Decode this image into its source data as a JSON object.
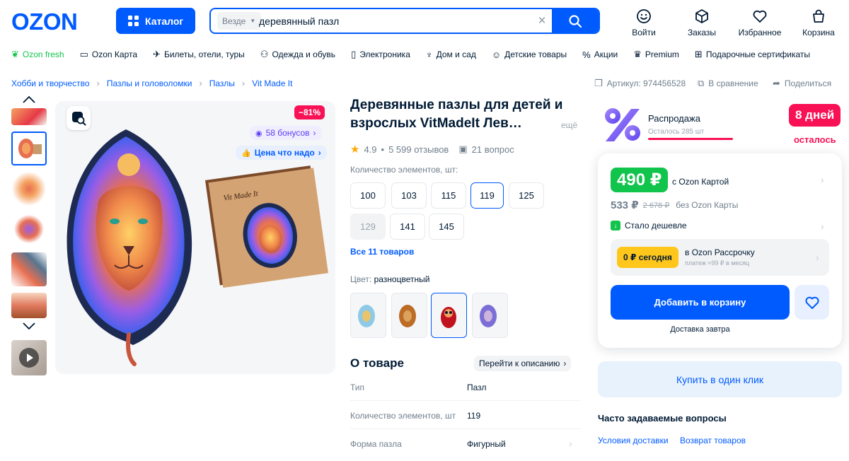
{
  "header": {
    "logo": "OZON",
    "catalog_label": "Каталог",
    "search_scope": "Везде",
    "search_value": "деревянный пазл",
    "items": [
      {
        "label": "Войти",
        "icon": "smile-icon"
      },
      {
        "label": "Заказы",
        "icon": "box-icon"
      },
      {
        "label": "Избранное",
        "icon": "heart-icon"
      },
      {
        "label": "Корзина",
        "icon": "cart-icon"
      }
    ]
  },
  "nav": [
    {
      "label": "Ozon fresh"
    },
    {
      "label": "Ozon Карта"
    },
    {
      "label": "Билеты, отели, туры"
    },
    {
      "label": "Одежда и обувь"
    },
    {
      "label": "Электроника"
    },
    {
      "label": "Дом и сад"
    },
    {
      "label": "Детские товары"
    },
    {
      "label": "Акции"
    },
    {
      "label": "Premium"
    },
    {
      "label": "Подарочные сертификаты"
    }
  ],
  "breadcrumb": [
    "Хобби и творчество",
    "Пазлы и головоломки",
    "Пазлы",
    "Vit Made It"
  ],
  "meta": {
    "article": "Артикул: 974456528",
    "compare": "В сравнение",
    "share": "Поделиться"
  },
  "gallery": {
    "discount": "−81%",
    "bonus": "58 бонусов",
    "price_tag": "Цена что надо",
    "box_text": "Vit Made It"
  },
  "product": {
    "title_line1": "Деревянные пазлы для детей и",
    "title_line2": "взрослых VitMadeIt Лев…",
    "more": "ещё",
    "rating": "4.9",
    "reviews": "5 599 отзывов",
    "questions": "21 вопрос",
    "count_label": "Количество элементов, шт:",
    "options": [
      "100",
      "103",
      "115",
      "119",
      "125",
      "129",
      "141",
      "145"
    ],
    "selected_option": "119",
    "all_products": "Все 11 товаров",
    "color_label": "Цвет:",
    "color_value": "разноцветный"
  },
  "about": {
    "title": "О товаре",
    "goto": "Перейти к описанию",
    "specs": [
      {
        "k": "Тип",
        "v": "Пазл"
      },
      {
        "k": "Количество элементов, шт",
        "v": "119"
      },
      {
        "k": "Форма пазла",
        "v": "Фигурный"
      }
    ]
  },
  "sale": {
    "title": "Распродажа",
    "left": "Осталось 285 шт",
    "days": "8 дней",
    "days_sub": "осталось"
  },
  "price": {
    "card_price": "490 ₽",
    "card_note": "с Ozon Картой",
    "regular": "533 ₽",
    "old": "2 678 ₽",
    "regular_note": "без Ozon Карты",
    "cheaper": "Стало дешевле",
    "installment_pill": "0 ₽ сегодня",
    "installment_title": "в Ozon Рассрочку",
    "installment_sub": "платеж ≈99 ₽ в месяц",
    "add_to_cart": "Добавить в корзину",
    "delivery": "Доставка завтра",
    "one_click": "Купить в один клик"
  },
  "faq": {
    "title": "Часто задаваемые вопросы",
    "links": [
      "Условия доставки",
      "Возврат товаров"
    ]
  },
  "colors": {
    "accent": "#005bff",
    "green": "#10c44c",
    "sale": "#f91155",
    "yellow": "#ffc61b"
  }
}
